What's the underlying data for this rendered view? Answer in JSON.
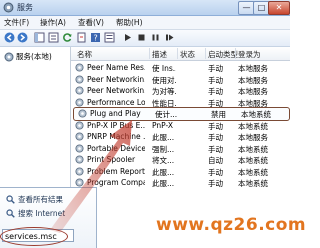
{
  "window": {
    "title": "服务"
  },
  "window_buttons": [
    "—",
    "□",
    "✕"
  ],
  "menu": [
    "文件(F)",
    "操作(A)",
    "查看(V)",
    "帮助(H)"
  ],
  "left_pane": {
    "item": "服务(本地)"
  },
  "columns": [
    "名称",
    "描述",
    "状态",
    "启动类型",
    "登录为"
  ],
  "rows": [
    {
      "name": "Peer Name Res...",
      "desc": "使 Ins...",
      "status": "",
      "startup": "手动",
      "logon": "本地服务"
    },
    {
      "name": "Peer Networkin...",
      "desc": "使用对...",
      "status": "",
      "startup": "手动",
      "logon": "本地服务"
    },
    {
      "name": "Peer Networkin...",
      "desc": "为对等...",
      "status": "",
      "startup": "手动",
      "logon": "本地服务"
    },
    {
      "name": "Performance Lo...",
      "desc": "性能日...",
      "status": "",
      "startup": "手动",
      "logon": "本地服务"
    },
    {
      "name": "Plug and Play",
      "desc": "使计...",
      "status": "",
      "startup": "禁用",
      "logon": "本地系统"
    },
    {
      "name": "PnP-X IP Bus E...",
      "desc": "PnP-X ...",
      "status": "",
      "startup": "手动",
      "logon": "本地系统"
    },
    {
      "name": "PNRP Machine ...",
      "desc": "此服...",
      "status": "",
      "startup": "手动",
      "logon": "本地服务"
    },
    {
      "name": "Portable Device ...",
      "desc": "强制...",
      "status": "",
      "startup": "手动",
      "logon": "本地系统"
    },
    {
      "name": "Print Spooler",
      "desc": "将文...",
      "status": "",
      "startup": "自动",
      "logon": "本地系统"
    },
    {
      "name": "Problem Report...",
      "desc": "此服...",
      "status": "",
      "startup": "手动",
      "logon": "本地系统"
    },
    {
      "name": "Program Compa...",
      "desc": "此服...",
      "status": "",
      "startup": "手动",
      "logon": "本地系统"
    }
  ],
  "selected_row": 4,
  "start_menu": {
    "see_all": "查看所有结果",
    "search_internet": "搜索 Internet",
    "search_value": "services.msc"
  },
  "watermark": "www.qz26.com",
  "colors": {
    "selection_border": "#7a4a35",
    "arrow": "#c0392b",
    "watermark": "#e2751f"
  }
}
